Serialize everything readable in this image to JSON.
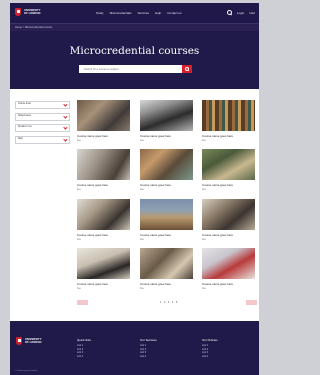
{
  "header": {
    "logo_line1": "UNIVERSITY",
    "logo_line2": "OF LONDON",
    "nav": [
      "Study",
      "Microcredentials",
      "Services",
      "Help",
      "Contact us"
    ],
    "right_links": [
      "Login",
      "Cart"
    ]
  },
  "breadcrumb": "Home > Microcredential courses",
  "hero": {
    "title": "Microcredential courses",
    "search_placeholder": "Search for a course or subject"
  },
  "filters": [
    "Course level",
    "Subject area",
    "Duration / fee",
    "Start"
  ],
  "courses": [
    {
      "title": "Course name goes here",
      "meta": "Fee"
    },
    {
      "title": "Course name goes here",
      "meta": "Fee"
    },
    {
      "title": "Course name goes here",
      "meta": "Fee"
    },
    {
      "title": "Course name goes here",
      "meta": "Fee"
    },
    {
      "title": "Course name goes here",
      "meta": "Fee"
    },
    {
      "title": "Course name goes here",
      "meta": "Fee"
    },
    {
      "title": "Course name goes here",
      "meta": "Fee"
    },
    {
      "title": "Course name goes here",
      "meta": "Fee"
    },
    {
      "title": "Course name goes here",
      "meta": "Fee"
    },
    {
      "title": "Course name goes here",
      "meta": "Fee"
    },
    {
      "title": "Course name goes here",
      "meta": "Fee"
    },
    {
      "title": "Course name goes here",
      "meta": "Fee"
    }
  ],
  "pagination": {
    "pages": [
      "1",
      "2",
      "3",
      "4",
      "5"
    ]
  },
  "footer": {
    "logo_line1": "UNIVERSITY",
    "logo_line2": "OF LONDON",
    "columns": [
      {
        "heading": "Quick links",
        "links": [
          "Link 1",
          "Link 2",
          "Link 3",
          "Link 4"
        ]
      },
      {
        "heading": "Our Services",
        "links": [
          "Link 1",
          "Link 2",
          "Link 3",
          "Link 4"
        ]
      },
      {
        "heading": "Our Policies",
        "links": [
          "Link 1",
          "Link 2",
          "Link 3",
          "Link 4"
        ]
      }
    ],
    "copyright": "© University of London"
  },
  "colors": {
    "navy": "#201a4a",
    "accent": "#d6202b"
  }
}
